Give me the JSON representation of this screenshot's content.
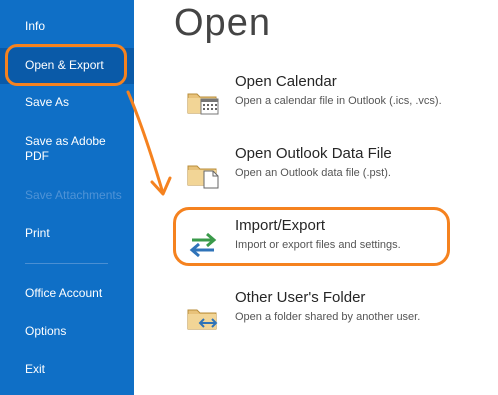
{
  "sidebar": {
    "items": [
      {
        "label": "Info"
      },
      {
        "label": "Open & Export"
      },
      {
        "label": "Save As"
      },
      {
        "label": "Save as Adobe PDF"
      },
      {
        "label": "Save Attachments"
      },
      {
        "label": "Print"
      },
      {
        "label": "Office Account"
      },
      {
        "label": "Options"
      },
      {
        "label": "Exit"
      }
    ]
  },
  "main": {
    "title": "Open",
    "options": [
      {
        "title": "Open Calendar",
        "description": "Open a calendar file in Outlook (.ics, .vcs).",
        "icon": "calendar-folder-icon"
      },
      {
        "title": "Open Outlook Data File",
        "description": "Open an Outlook data file (.pst).",
        "icon": "data-file-folder-icon"
      },
      {
        "title": "Import/Export",
        "description": "Import or export files and settings.",
        "icon": "import-export-arrows-icon"
      },
      {
        "title": "Other User's Folder",
        "description": "Open a folder shared by another user.",
        "icon": "shared-folder-icon"
      }
    ]
  },
  "colors": {
    "sidebar_bg": "#0f6fc6",
    "annotation": "#f5821f"
  }
}
